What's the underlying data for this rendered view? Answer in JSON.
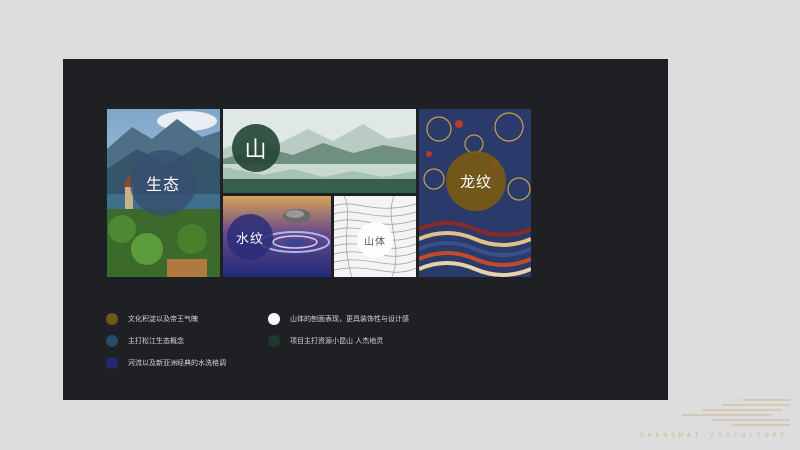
{
  "collage": {
    "eco_label": "生态",
    "mount_label": "山",
    "water_label": "水纹",
    "relief_label": "山体",
    "dragon_label": "龙纹"
  },
  "legend": {
    "items": [
      {
        "text": "文化积淀以及帝王气魄",
        "color": "#6e5a1c"
      },
      {
        "text": "主打松江生态概念",
        "color": "#2d4a6b"
      },
      {
        "text": "河流以及新亚洲经典的水洗格调",
        "color": "#25286b"
      },
      {
        "text": "山体的刨面表现，更具装饰性与设计感",
        "color": "#ffffff"
      },
      {
        "text": "项目主打资源小昆山 人杰地灵",
        "color": "#1f3a2c"
      }
    ]
  },
  "footer": {
    "brand_text": "SHANGHAI·ZOOCULTURE·LIFESTYLE"
  }
}
